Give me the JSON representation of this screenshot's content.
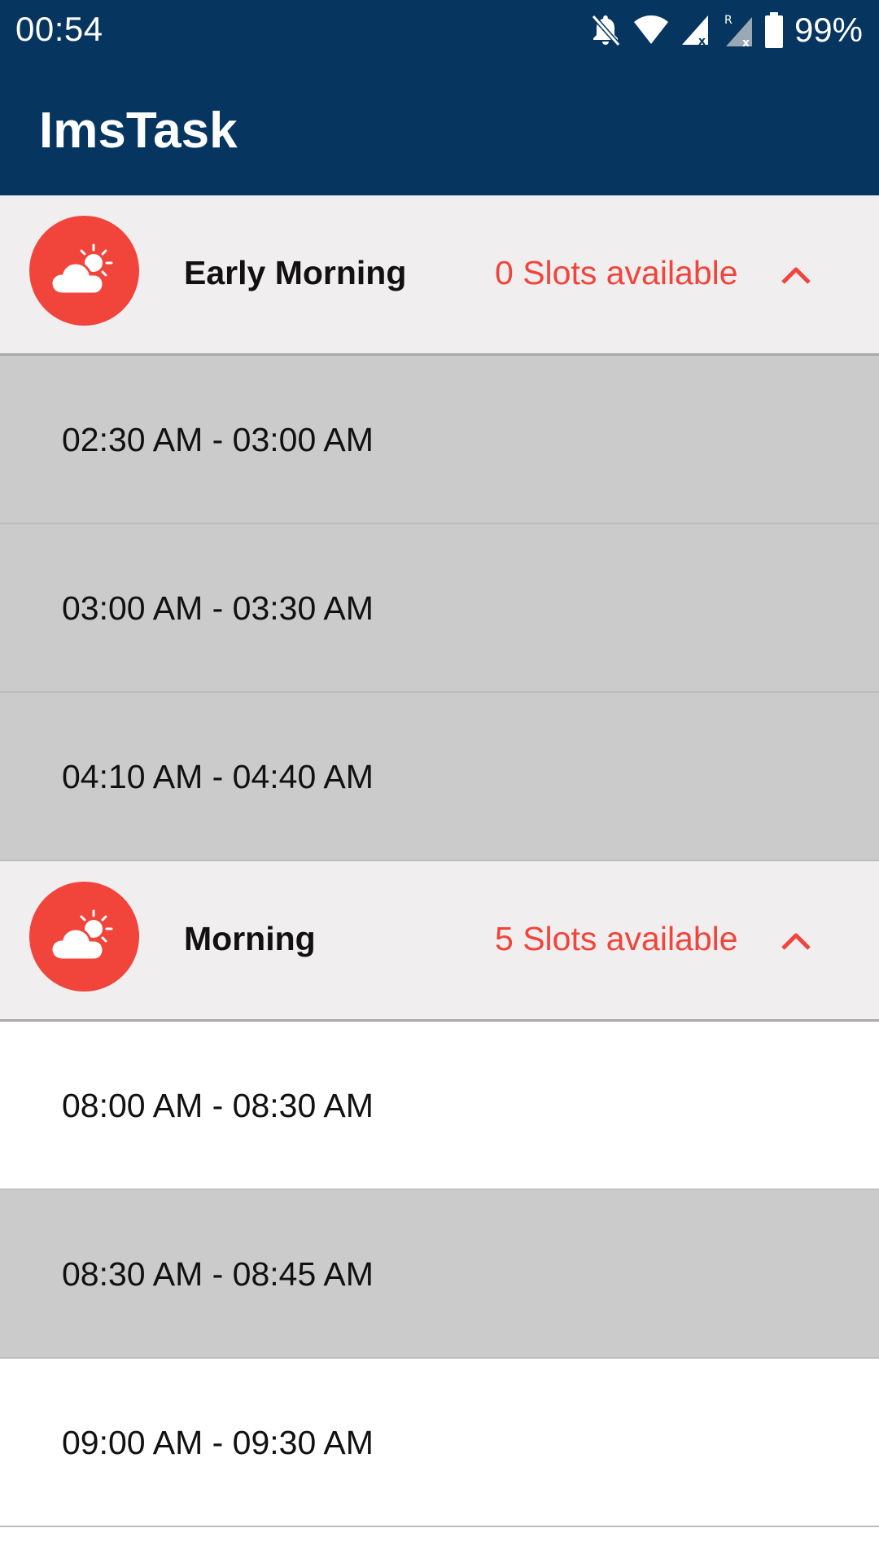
{
  "status_bar": {
    "time": "00:54",
    "battery": "99%",
    "icons": [
      "bell-off-icon",
      "wifi-icon",
      "signal-icon",
      "signal-roaming-icon",
      "battery-icon"
    ]
  },
  "app_bar": {
    "title": "ImsTask"
  },
  "colors": {
    "primary": "#063660",
    "accent": "#f1443b",
    "header_bg": "#f0eeef",
    "slot_gray": "#cbcbcb"
  },
  "groups": [
    {
      "title": "Early Morning",
      "slots_text": "0 Slots available",
      "icon": "cloud-sun-icon",
      "expanded": true,
      "slots": [
        {
          "label": "02:30 AM - 03:00 AM"
        },
        {
          "label": "03:00 AM - 03:30 AM"
        },
        {
          "label": "04:10 AM - 04:40 AM"
        }
      ]
    },
    {
      "title": "Morning",
      "slots_text": "5 Slots available",
      "icon": "cloud-sun-icon",
      "expanded": true,
      "slots": [
        {
          "label": "08:00 AM - 08:30 AM"
        },
        {
          "label": "08:30 AM - 08:45 AM"
        },
        {
          "label": "09:00 AM - 09:30 AM"
        }
      ]
    }
  ]
}
